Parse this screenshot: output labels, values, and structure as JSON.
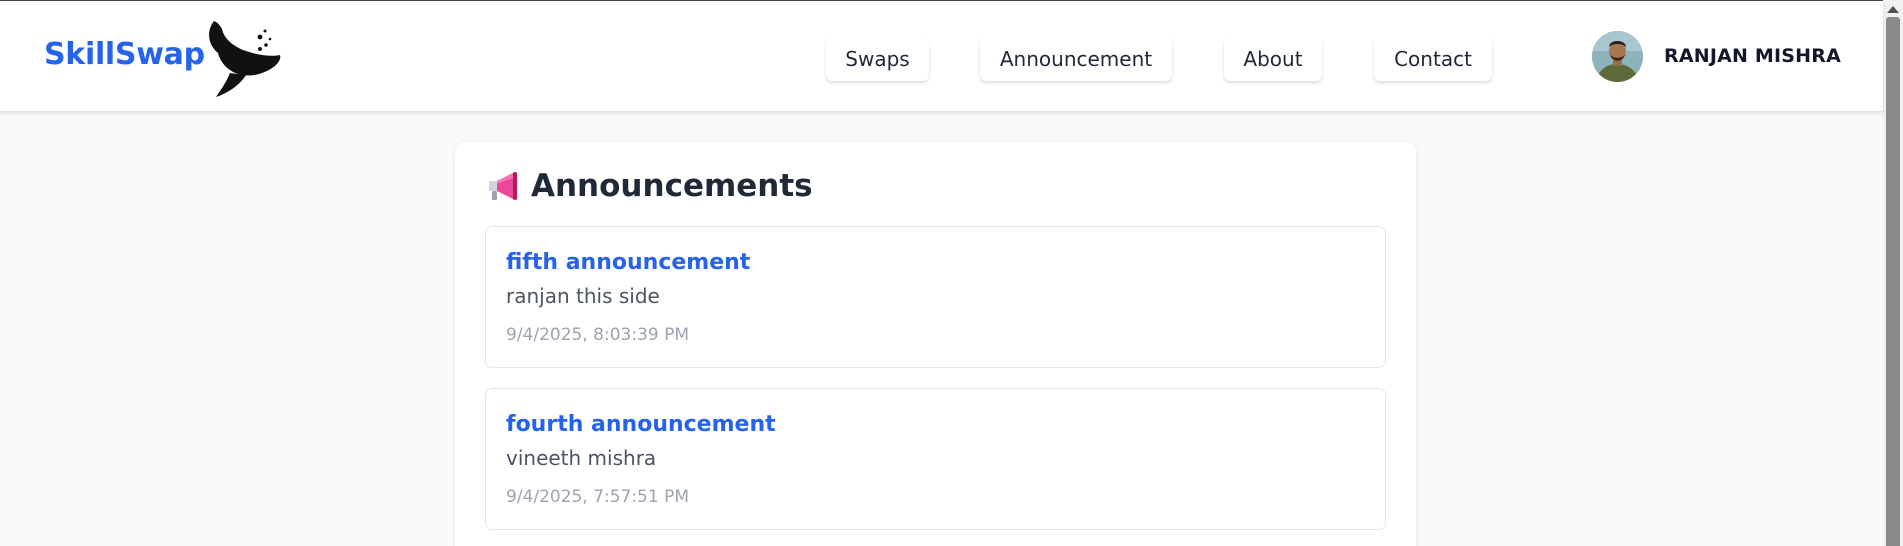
{
  "brand": {
    "name": "SkillSwap",
    "logo_icon": "whale-logo-icon"
  },
  "nav": {
    "items": [
      {
        "label": "Swaps"
      },
      {
        "label": "Announcement"
      },
      {
        "label": "About"
      },
      {
        "label": "Contact"
      }
    ]
  },
  "user": {
    "name": "RANJAN MISHRA",
    "avatar_icon": "user-avatar"
  },
  "page": {
    "title": "Announcements",
    "title_icon": "megaphone-icon"
  },
  "announcements": [
    {
      "title": "fifth announcement",
      "body": "ranjan this side",
      "timestamp": "9/4/2025, 8:03:39 PM"
    },
    {
      "title": "fourth announcement",
      "body": "vineeth mishra",
      "timestamp": "9/4/2025, 7:57:51 PM"
    }
  ],
  "colors": {
    "accent": "#2563eb",
    "text_primary": "#1f2937",
    "text_secondary": "#4b5563",
    "text_muted": "#9ca3af",
    "background": "#f9fafb"
  }
}
